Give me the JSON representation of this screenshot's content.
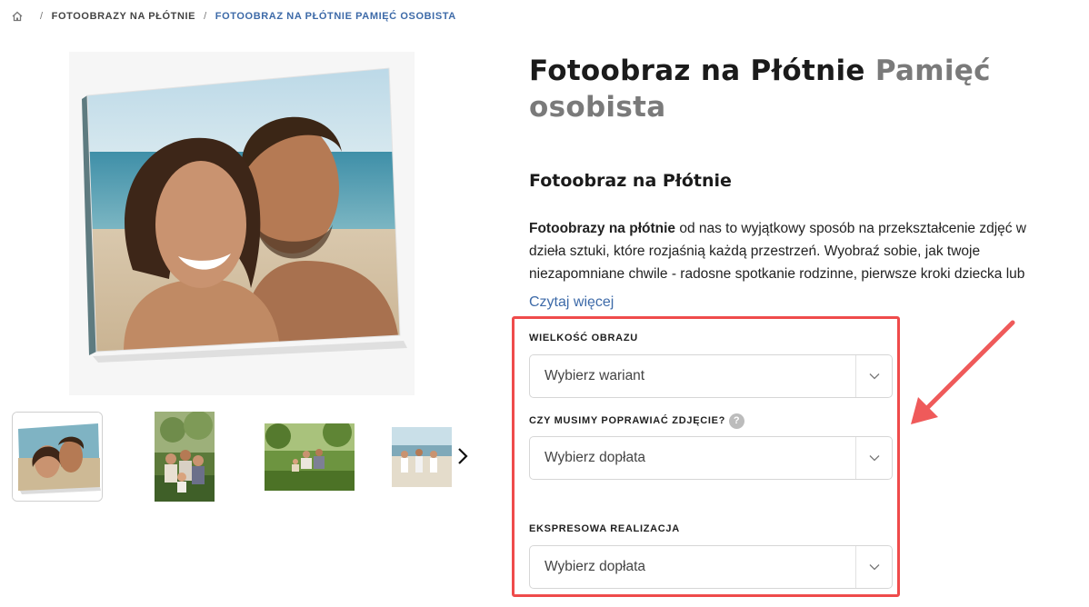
{
  "breadcrumb": {
    "items": [
      "Fotoobrazy na Płótnie",
      "Fotoobraz na Płótnie Pamięć osobista"
    ],
    "separator": "/"
  },
  "product": {
    "title_main": "Fotoobraz na Płótnie",
    "title_variant": "Pamięć osobista",
    "subtitle": "Fotoobraz na Płótnie",
    "description_bold": "Fotoobrazy na płótnie",
    "description_rest": " od nas to wyjątkowy sposób na przekształcenie zdjęć w dzieła sztuki, które rozjaśnią każdą przestrzeń. Wyobraź sobie, jak twoje niezapomniane chwile - radosne spotkanie rodzinne, pierwsze kroki dziecka lub",
    "read_more": "Czytaj więcej"
  },
  "options": [
    {
      "label": "WIELKOŚĆ OBRAZU",
      "value": "Wybierz wariant",
      "help": false
    },
    {
      "label": "CZY MUSIMY POPRAWIAĆ ZDJĘCIE?",
      "value": "Wybierz dopłata",
      "help": true,
      "help_glyph": "?"
    },
    {
      "label": "EKSPRESOWA REALIZACJA",
      "value": "Wybierz dopłata",
      "help": false
    }
  ],
  "icons": {
    "home": "home-icon",
    "chevron": "chevron-down-icon",
    "next": "chevron-right-icon"
  },
  "colors": {
    "accent_link": "#3d6aa8",
    "highlight": "#ef4b4b",
    "title_variant": "#7a7a7a"
  }
}
